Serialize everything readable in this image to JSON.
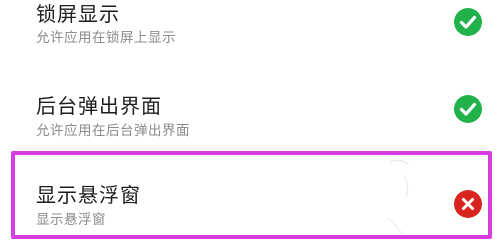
{
  "settings": [
    {
      "title": "锁屏显示",
      "subtitle": "允许应用在锁屏上显示",
      "status": "check-icon",
      "enabled": true
    },
    {
      "title": "后台弹出界面",
      "subtitle": "允许应用在后台弹出界面",
      "status": "check-icon",
      "enabled": true
    },
    {
      "title": "显示悬浮窗",
      "subtitle": "显示悬浮窗",
      "status": "close-icon",
      "enabled": false,
      "highlighted": true
    }
  ],
  "colors": {
    "enabled": "#22b24c",
    "disabled": "#d9251f",
    "highlight_border": "#d63ee3",
    "title_text": "#1e1e1e",
    "subtitle_text": "#8b8b8b"
  }
}
